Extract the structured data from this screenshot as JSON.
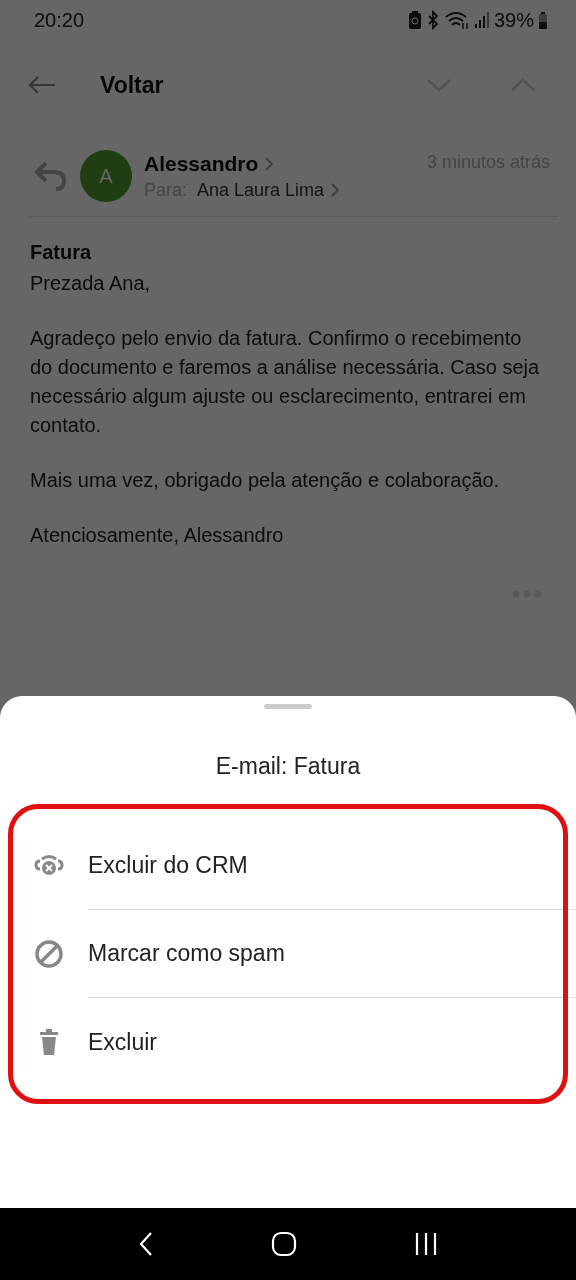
{
  "status_bar": {
    "time": "20:20",
    "battery": "39%"
  },
  "header": {
    "title": "Voltar"
  },
  "message": {
    "sender": "Alessandro",
    "avatar_letter": "A",
    "to_label": "Para:",
    "recipient": "Ana Laura Lima",
    "time": "3 minutos atrás",
    "subject": "Fatura",
    "paragraphs": [
      "Prezada Ana,",
      "Agradeço pelo envio da fatura. Confirmo o recebimento do documento e faremos a análise necessária. Caso seja necessário algum ajuste ou esclarecimento, entrarei em contato.",
      "Mais uma vez, obrigado pela atenção e colaboração.",
      "Atenciosamente, Alessandro"
    ]
  },
  "sheet": {
    "title": "E-mail: Fatura",
    "highlighted": true,
    "actions": [
      {
        "kind": "crm",
        "label": "Excluir do CRM"
      },
      {
        "kind": "spam",
        "label": "Marcar como spam"
      },
      {
        "kind": "delete",
        "label": "Excluir"
      }
    ]
  }
}
